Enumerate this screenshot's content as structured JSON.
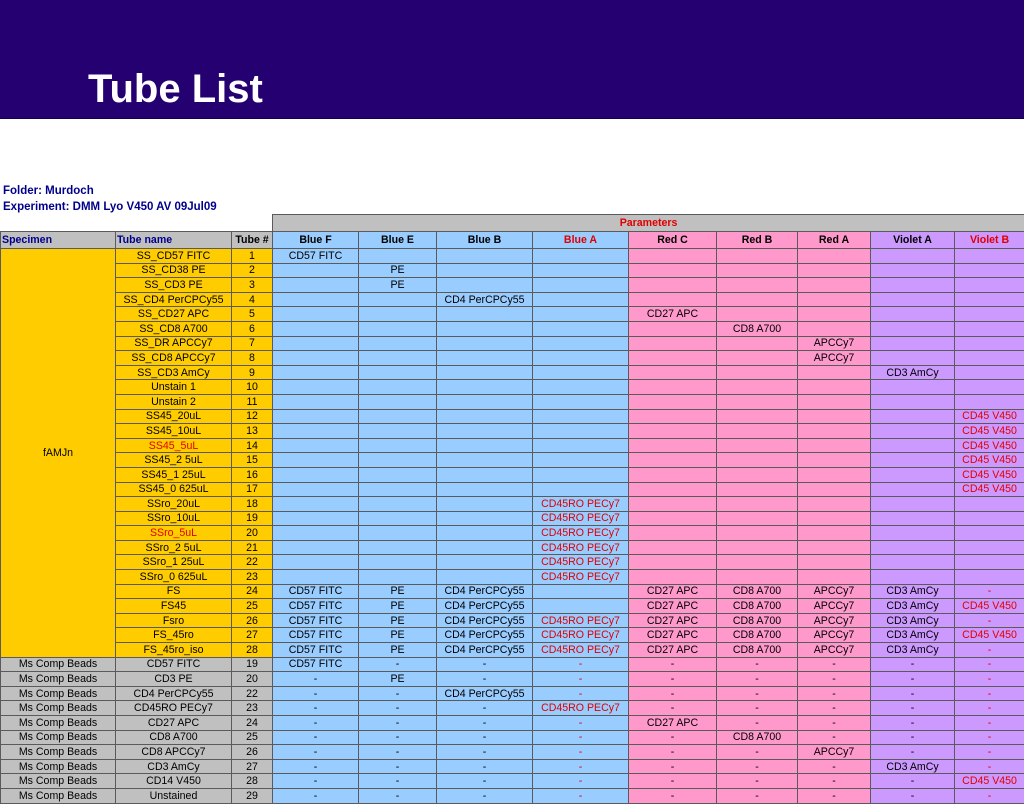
{
  "title": "Tube List",
  "folder": "Folder: Murdoch",
  "experiment": "Experiment: DMM Lyo V450 AV 09Jul09",
  "parameters_label": "Parameters",
  "headers": [
    "Specimen",
    "Tube name",
    "Tube #",
    "Blue F",
    "Blue E",
    "Blue B",
    "Blue A",
    "Red C",
    "Red B",
    "Red A",
    "Violet A",
    "Violet B"
  ],
  "colors": {
    "header_bg": "#240070",
    "blue": "#99ccff",
    "pink": "#ff99cc",
    "purple": "#cc99ff",
    "yellow": "#ffcc00",
    "grey": "#c0c0c0",
    "red_text": "#e00000",
    "navy_text": "#00008b"
  },
  "specimen_famjn": "fAMJn",
  "rows_famjn": [
    {
      "name": "SS_CD57 FITC",
      "num": "1",
      "vals": [
        "CD57 FITC",
        "",
        "",
        "",
        "",
        "",
        "",
        "",
        ""
      ]
    },
    {
      "name": "SS_CD38 PE",
      "num": "2",
      "vals": [
        "",
        "PE",
        "",
        "",
        "",
        "",
        "",
        "",
        ""
      ]
    },
    {
      "name": "SS_CD3 PE",
      "num": "3",
      "vals": [
        "",
        "PE",
        "",
        "",
        "",
        "",
        "",
        "",
        ""
      ]
    },
    {
      "name": "SS_CD4 PerCPCy55",
      "num": "4",
      "vals": [
        "",
        "",
        "CD4 PerCPCy55",
        "",
        "",
        "",
        "",
        "",
        ""
      ]
    },
    {
      "name": "SS_CD27 APC",
      "num": "5",
      "vals": [
        "",
        "",
        "",
        "",
        "CD27 APC",
        "",
        "",
        "",
        ""
      ]
    },
    {
      "name": "SS_CD8 A700",
      "num": "6",
      "vals": [
        "",
        "",
        "",
        "",
        "",
        "CD8 A700",
        "",
        "",
        ""
      ]
    },
    {
      "name": "SS_DR APCCy7",
      "num": "7",
      "vals": [
        "",
        "",
        "",
        "",
        "",
        "",
        "APCCy7",
        "",
        ""
      ]
    },
    {
      "name": "SS_CD8 APCCy7",
      "num": "8",
      "vals": [
        "",
        "",
        "",
        "",
        "",
        "",
        "APCCy7",
        "",
        ""
      ]
    },
    {
      "name": "SS_CD3 AmCy",
      "num": "9",
      "vals": [
        "",
        "",
        "",
        "",
        "",
        "",
        "",
        "CD3 AmCy",
        ""
      ]
    },
    {
      "name": "Unstain 1",
      "num": "10",
      "vals": [
        "",
        "",
        "",
        "",
        "",
        "",
        "",
        "",
        ""
      ]
    },
    {
      "name": "Unstain 2",
      "num": "11",
      "vals": [
        "",
        "",
        "",
        "",
        "",
        "",
        "",
        "",
        ""
      ]
    },
    {
      "name": "SS45_20uL",
      "num": "12",
      "group_start": true,
      "vals": [
        "",
        "",
        "",
        "",
        "",
        "",
        "",
        "",
        "CD45 V450"
      ]
    },
    {
      "name": "SS45_10uL",
      "num": "13",
      "vals": [
        "",
        "",
        "",
        "",
        "",
        "",
        "",
        "",
        "CD45 V450"
      ]
    },
    {
      "name": "SS45_5uL",
      "num": "14",
      "red": true,
      "vals": [
        "",
        "",
        "",
        "",
        "",
        "",
        "",
        "",
        "CD45 V450"
      ]
    },
    {
      "name": "SS45_2 5uL",
      "num": "15",
      "vals": [
        "",
        "",
        "",
        "",
        "",
        "",
        "",
        "",
        "CD45 V450"
      ]
    },
    {
      "name": "SS45_1 25uL",
      "num": "16",
      "vals": [
        "",
        "",
        "",
        "",
        "",
        "",
        "",
        "",
        "CD45 V450"
      ]
    },
    {
      "name": "SS45_0 625uL",
      "num": "17",
      "vals": [
        "",
        "",
        "",
        "",
        "",
        "",
        "",
        "",
        "CD45 V450"
      ]
    },
    {
      "name": "SSro_20uL",
      "num": "18",
      "group_start": true,
      "vals": [
        "",
        "",
        "",
        "CD45RO PECy7",
        "",
        "",
        "",
        "",
        ""
      ]
    },
    {
      "name": "SSro_10uL",
      "num": "19",
      "vals": [
        "",
        "",
        "",
        "CD45RO PECy7",
        "",
        "",
        "",
        "",
        ""
      ]
    },
    {
      "name": "SSro_5uL",
      "num": "20",
      "red": true,
      "vals": [
        "",
        "",
        "",
        "CD45RO PECy7",
        "",
        "",
        "",
        "",
        ""
      ]
    },
    {
      "name": "SSro_2 5uL",
      "num": "21",
      "vals": [
        "",
        "",
        "",
        "CD45RO PECy7",
        "",
        "",
        "",
        "",
        ""
      ]
    },
    {
      "name": "SSro_1 25uL",
      "num": "22",
      "vals": [
        "",
        "",
        "",
        "CD45RO PECy7",
        "",
        "",
        "",
        "",
        ""
      ]
    },
    {
      "name": "SSro_0 625uL",
      "num": "23",
      "vals": [
        "",
        "",
        "",
        "CD45RO PECy7",
        "",
        "",
        "",
        "",
        ""
      ]
    },
    {
      "name": "FS",
      "num": "24",
      "group_start": true,
      "vals": [
        "CD57 FITC",
        "PE",
        "CD4 PerCPCy55",
        "",
        "CD27 APC",
        "CD8 A700",
        "APCCy7",
        "CD3 AmCy",
        "-"
      ]
    },
    {
      "name": "FS45",
      "num": "25",
      "vals": [
        "CD57 FITC",
        "PE",
        "CD4 PerCPCy55",
        "",
        "CD27 APC",
        "CD8 A700",
        "APCCy7",
        "CD3 AmCy",
        "CD45 V450"
      ]
    },
    {
      "name": "Fsro",
      "num": "26",
      "vals": [
        "CD57 FITC",
        "PE",
        "CD4 PerCPCy55",
        "CD45RO PECy7",
        "CD27 APC",
        "CD8 A700",
        "APCCy7",
        "CD3 AmCy",
        "-"
      ]
    },
    {
      "name": "FS_45ro",
      "num": "27",
      "vals": [
        "CD57 FITC",
        "PE",
        "CD4 PerCPCy55",
        "CD45RO PECy7",
        "CD27 APC",
        "CD8 A700",
        "APCCy7",
        "CD3 AmCy",
        "CD45 V450"
      ]
    },
    {
      "name": "FS_45ro_iso",
      "num": "28",
      "vals": [
        "CD57 FITC",
        "PE",
        "CD4 PerCPCy55",
        "CD45RO PECy7",
        "CD27 APC",
        "CD8 A700",
        "APCCy7",
        "CD3 AmCy",
        "-"
      ]
    }
  ],
  "rows_comp": [
    {
      "spec": "Ms Comp Beads",
      "name": "CD57 FITC",
      "num": "19",
      "vals": [
        "CD57 FITC",
        "-",
        "-",
        "-",
        "-",
        "-",
        "-",
        "-",
        "-"
      ]
    },
    {
      "spec": "Ms Comp Beads",
      "name": "CD3 PE",
      "num": "20",
      "vals": [
        "-",
        "PE",
        "-",
        "-",
        "-",
        "-",
        "-",
        "-",
        "-"
      ]
    },
    {
      "spec": "Ms Comp Beads",
      "name": "CD4 PerCPCy55",
      "num": "22",
      "vals": [
        "-",
        "-",
        "CD4 PerCPCy55",
        "-",
        "-",
        "-",
        "-",
        "-",
        "-"
      ]
    },
    {
      "spec": "Ms Comp Beads",
      "name": "CD45RO PECy7",
      "num": "23",
      "vals": [
        "-",
        "-",
        "-",
        "CD45RO PECy7",
        "-",
        "-",
        "-",
        "-",
        "-"
      ]
    },
    {
      "spec": "Ms Comp Beads",
      "name": "CD27 APC",
      "num": "24",
      "vals": [
        "-",
        "-",
        "-",
        "-",
        "CD27 APC",
        "-",
        "-",
        "-",
        "-"
      ]
    },
    {
      "spec": "Ms Comp Beads",
      "name": "CD8 A700",
      "num": "25",
      "vals": [
        "-",
        "-",
        "-",
        "-",
        "-",
        "CD8 A700",
        "-",
        "-",
        "-"
      ]
    },
    {
      "spec": "Ms Comp Beads",
      "name": "CD8 APCCy7",
      "num": "26",
      "vals": [
        "-",
        "-",
        "-",
        "-",
        "-",
        "-",
        "APCCy7",
        "-",
        "-"
      ]
    },
    {
      "spec": "Ms Comp Beads",
      "name": "CD3 AmCy",
      "num": "27",
      "vals": [
        "-",
        "-",
        "-",
        "-",
        "-",
        "-",
        "-",
        "CD3 AmCy",
        "-"
      ]
    },
    {
      "spec": "Ms Comp Beads",
      "name": "CD14 V450",
      "num": "28",
      "vals": [
        "-",
        "-",
        "-",
        "-",
        "-",
        "-",
        "-",
        "-",
        "CD45 V450"
      ]
    },
    {
      "spec": "Ms Comp Beads",
      "name": "Unstained",
      "num": "29",
      "vals": [
        "-",
        "-",
        "-",
        "-",
        "-",
        "-",
        "-",
        "-",
        "-"
      ]
    }
  ]
}
